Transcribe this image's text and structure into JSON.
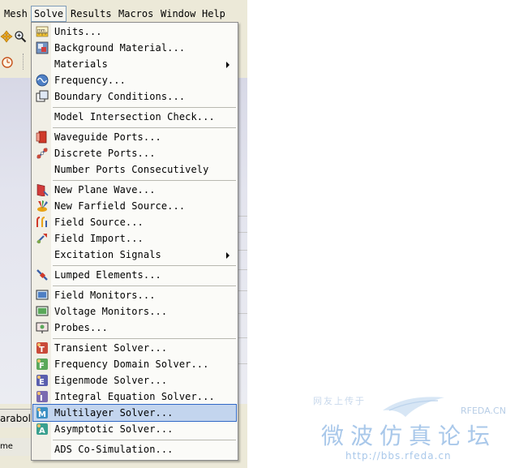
{
  "menubar": [
    {
      "id": "mesh",
      "label": "Mesh"
    },
    {
      "id": "solve",
      "label": "Solve"
    },
    {
      "id": "results",
      "label": "Results"
    },
    {
      "id": "macros",
      "label": "Macros"
    },
    {
      "id": "window",
      "label": "Window"
    },
    {
      "id": "help",
      "label": "Help"
    }
  ],
  "bottom_tab_label": "araboli",
  "bottom_status_label": "me",
  "solve_menu": {
    "units": {
      "label": "Units...",
      "icon": "units-icon"
    },
    "background_material": {
      "label": "Background Material...",
      "icon": "background-material-icon"
    },
    "materials": {
      "label": "Materials",
      "icon": "",
      "submenu": true
    },
    "frequency": {
      "label": "Frequency...",
      "icon": "frequency-icon"
    },
    "boundary_conditions": {
      "label": "Boundary Conditions...",
      "icon": "boundary-conditions-icon"
    },
    "model_intersection_check": {
      "label": "Model Intersection Check...",
      "icon": ""
    },
    "waveguide_ports": {
      "label": "Waveguide Ports...",
      "icon": "waveguide-port-icon"
    },
    "discrete_ports": {
      "label": "Discrete Ports...",
      "icon": "discrete-port-icon"
    },
    "number_ports": {
      "label": "Number Ports Consecutively",
      "icon": ""
    },
    "new_plane_wave": {
      "label": "New Plane Wave...",
      "icon": "plane-wave-icon"
    },
    "new_farfield_source": {
      "label": "New Farfield Source...",
      "icon": "farfield-source-icon"
    },
    "field_source": {
      "label": "Field Source...",
      "icon": "field-source-icon"
    },
    "field_import": {
      "label": "Field Import...",
      "icon": "field-import-icon"
    },
    "excitation_signals": {
      "label": "Excitation Signals",
      "icon": "",
      "submenu": true
    },
    "lumped_elements": {
      "label": "Lumped Elements...",
      "icon": "lumped-element-icon"
    },
    "field_monitors": {
      "label": "Field Monitors...",
      "icon": "field-monitor-icon"
    },
    "voltage_monitors": {
      "label": "Voltage Monitors...",
      "icon": "voltage-monitor-icon"
    },
    "probes": {
      "label": "Probes...",
      "icon": "probe-icon"
    },
    "transient_solver": {
      "label": "Transient Solver...",
      "icon": "transient-solver-icon"
    },
    "frequency_domain_solver": {
      "label": "Frequency Domain Solver...",
      "icon": "frequency-domain-solver-icon"
    },
    "eigenmode_solver": {
      "label": "Eigenmode Solver...",
      "icon": "eigenmode-solver-icon"
    },
    "integral_equation_solver": {
      "label": "Integral Equation Solver...",
      "icon": "integral-equation-solver-icon"
    },
    "multilayer_solver": {
      "label": "Multilayer Solver...",
      "icon": "multilayer-solver-icon",
      "highlighted": true
    },
    "asymptotic_solver": {
      "label": "Asymptotic Solver...",
      "icon": "asymptotic-solver-icon"
    },
    "ads_cosimulation": {
      "label": "ADS Co-Simulation...",
      "icon": ""
    }
  },
  "watermark": {
    "slogan": "网友上传于",
    "brand": "RFEDA.CN",
    "title": "微波仿真论坛",
    "url": "http://bbs.rfeda.cn"
  },
  "colors": {
    "menu_highlight": "#c3d5ee",
    "menu_highlight_border": "#3169c6",
    "watermark_blue": "#9fc3ea"
  }
}
